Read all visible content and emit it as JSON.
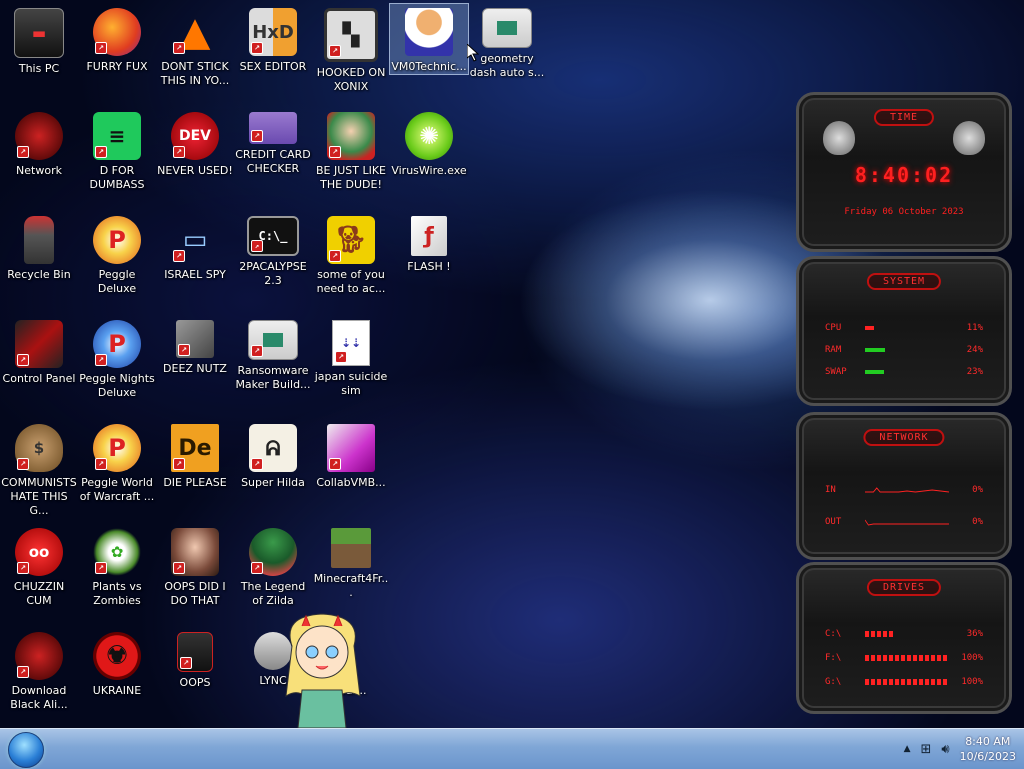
{
  "desktop": {
    "icons": [
      {
        "label": "This PC"
      },
      {
        "label": "FURRY FUX"
      },
      {
        "label": "DONT STICK THIS IN YO..."
      },
      {
        "label": "SEX EDITOR"
      },
      {
        "label": "HOOKED ON XONIX"
      },
      {
        "label": "VM0Technic..."
      },
      {
        "label": "geometry dash auto s..."
      },
      {
        "label": "Network"
      },
      {
        "label": "D FOR DUMBASS"
      },
      {
        "label": "NEVER USED!"
      },
      {
        "label": "CREDIT CARD CHECKER"
      },
      {
        "label": "BE JUST LIKE THE DUDE!"
      },
      {
        "label": "VirusWire.exe"
      },
      {
        "label": "Recycle Bin"
      },
      {
        "label": "Peggle Deluxe"
      },
      {
        "label": "ISRAEL SPY"
      },
      {
        "label": "2PACALYPSE 2.3"
      },
      {
        "label": "some of you need to ac..."
      },
      {
        "label": "FLASH !"
      },
      {
        "label": "Control Panel"
      },
      {
        "label": "Peggle Nights Deluxe"
      },
      {
        "label": "DEEZ NUTZ"
      },
      {
        "label": "Ransomware Maker Build..."
      },
      {
        "label": "japan suicide sim"
      },
      {
        "label": "COMMUNISTS HATE THIS G..."
      },
      {
        "label": "Peggle World of Warcraft ..."
      },
      {
        "label": "DIE PLEASE"
      },
      {
        "label": "Super Hilda"
      },
      {
        "label": "CollabVMB..."
      },
      {
        "label": "CHUZZIN CUM"
      },
      {
        "label": "Plants vs Zombies"
      },
      {
        "label": "OOPS DID I DO THAT"
      },
      {
        "label": "The Legend of Zilda"
      },
      {
        "label": "Minecraft4Fr..."
      },
      {
        "label": "Download Black Ali..."
      },
      {
        "label": "UKRAINE"
      },
      {
        "label": "OOPS"
      },
      {
        "label": "LYNC"
      },
      {
        "label": "War..."
      }
    ]
  },
  "widgets": {
    "time": {
      "title": "TIME",
      "clock": "8:40:02",
      "date": "Friday 06 October 2023"
    },
    "system": {
      "title": "SYSTEM",
      "cpu_label": "CPU",
      "cpu_value": "11%",
      "cpu_pct": 11,
      "ram_label": "RAM",
      "ram_value": "24%",
      "ram_pct": 24,
      "swap_label": "SWAP",
      "swap_value": "23%",
      "swap_pct": 23
    },
    "network": {
      "title": "NETWORK",
      "in_label": "IN",
      "in_value": "0%",
      "out_label": "OUT",
      "out_value": "0%"
    },
    "drives": {
      "title": "DRIVES",
      "c_label": "C:\\",
      "c_value": "36%",
      "c_pct": 36,
      "f_label": "F:\\",
      "f_value": "100%",
      "f_pct": 100,
      "g_label": "G:\\",
      "g_value": "100%",
      "g_pct": 100
    }
  },
  "taskbar": {
    "time": "8:40 AM",
    "date": "10/6/2023"
  },
  "colors": {
    "accent_red": "#ff2a2a",
    "taskbar": "#7fa6d6",
    "selection": "#8096c8"
  }
}
